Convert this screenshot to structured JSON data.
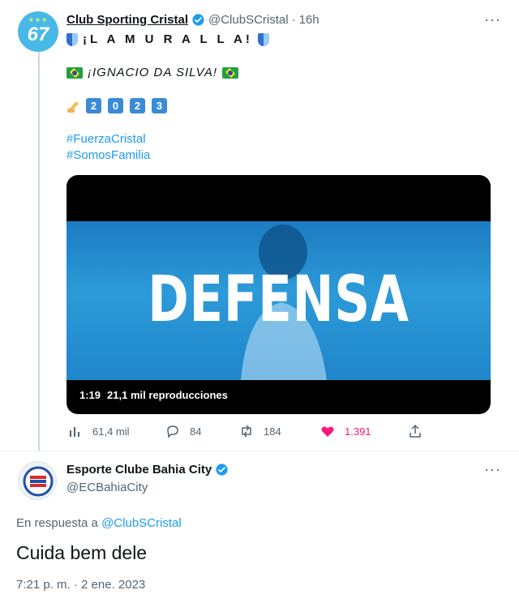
{
  "tweet1": {
    "author_name": "Club Sporting Cristal",
    "handle": "@ClubSCristal",
    "separator": "·",
    "time": "16h",
    "avatar_stars": "★★★",
    "avatar_number": "67",
    "line1": "¡L A  M U R A L L A!",
    "line2": "¡IGNACIO DA SILVA!",
    "year_digits": [
      "2",
      "0",
      "2",
      "3"
    ],
    "hashtags": [
      "#FuerzaCristal",
      "#SomosFamilia"
    ],
    "video": {
      "word": "DEFENSA",
      "duration": "1:19",
      "views": "21,1 mil reproducciones"
    },
    "actions": {
      "views": "61,4 mil",
      "replies": "84",
      "retweets": "184",
      "likes": "1.391"
    },
    "colors": {
      "accent": "#1d9bf0",
      "like": "#f91880"
    }
  },
  "tweet2": {
    "author_name": "Esporte Clube Bahia City",
    "handle": "@ECBahiaCity",
    "reply_prefix": "En respuesta a",
    "reply_to": "@ClubSCristal",
    "text": "Cuida bem dele",
    "timestamp": "7:21 p. m. · 2 ene. 2023"
  },
  "more_label": "···"
}
